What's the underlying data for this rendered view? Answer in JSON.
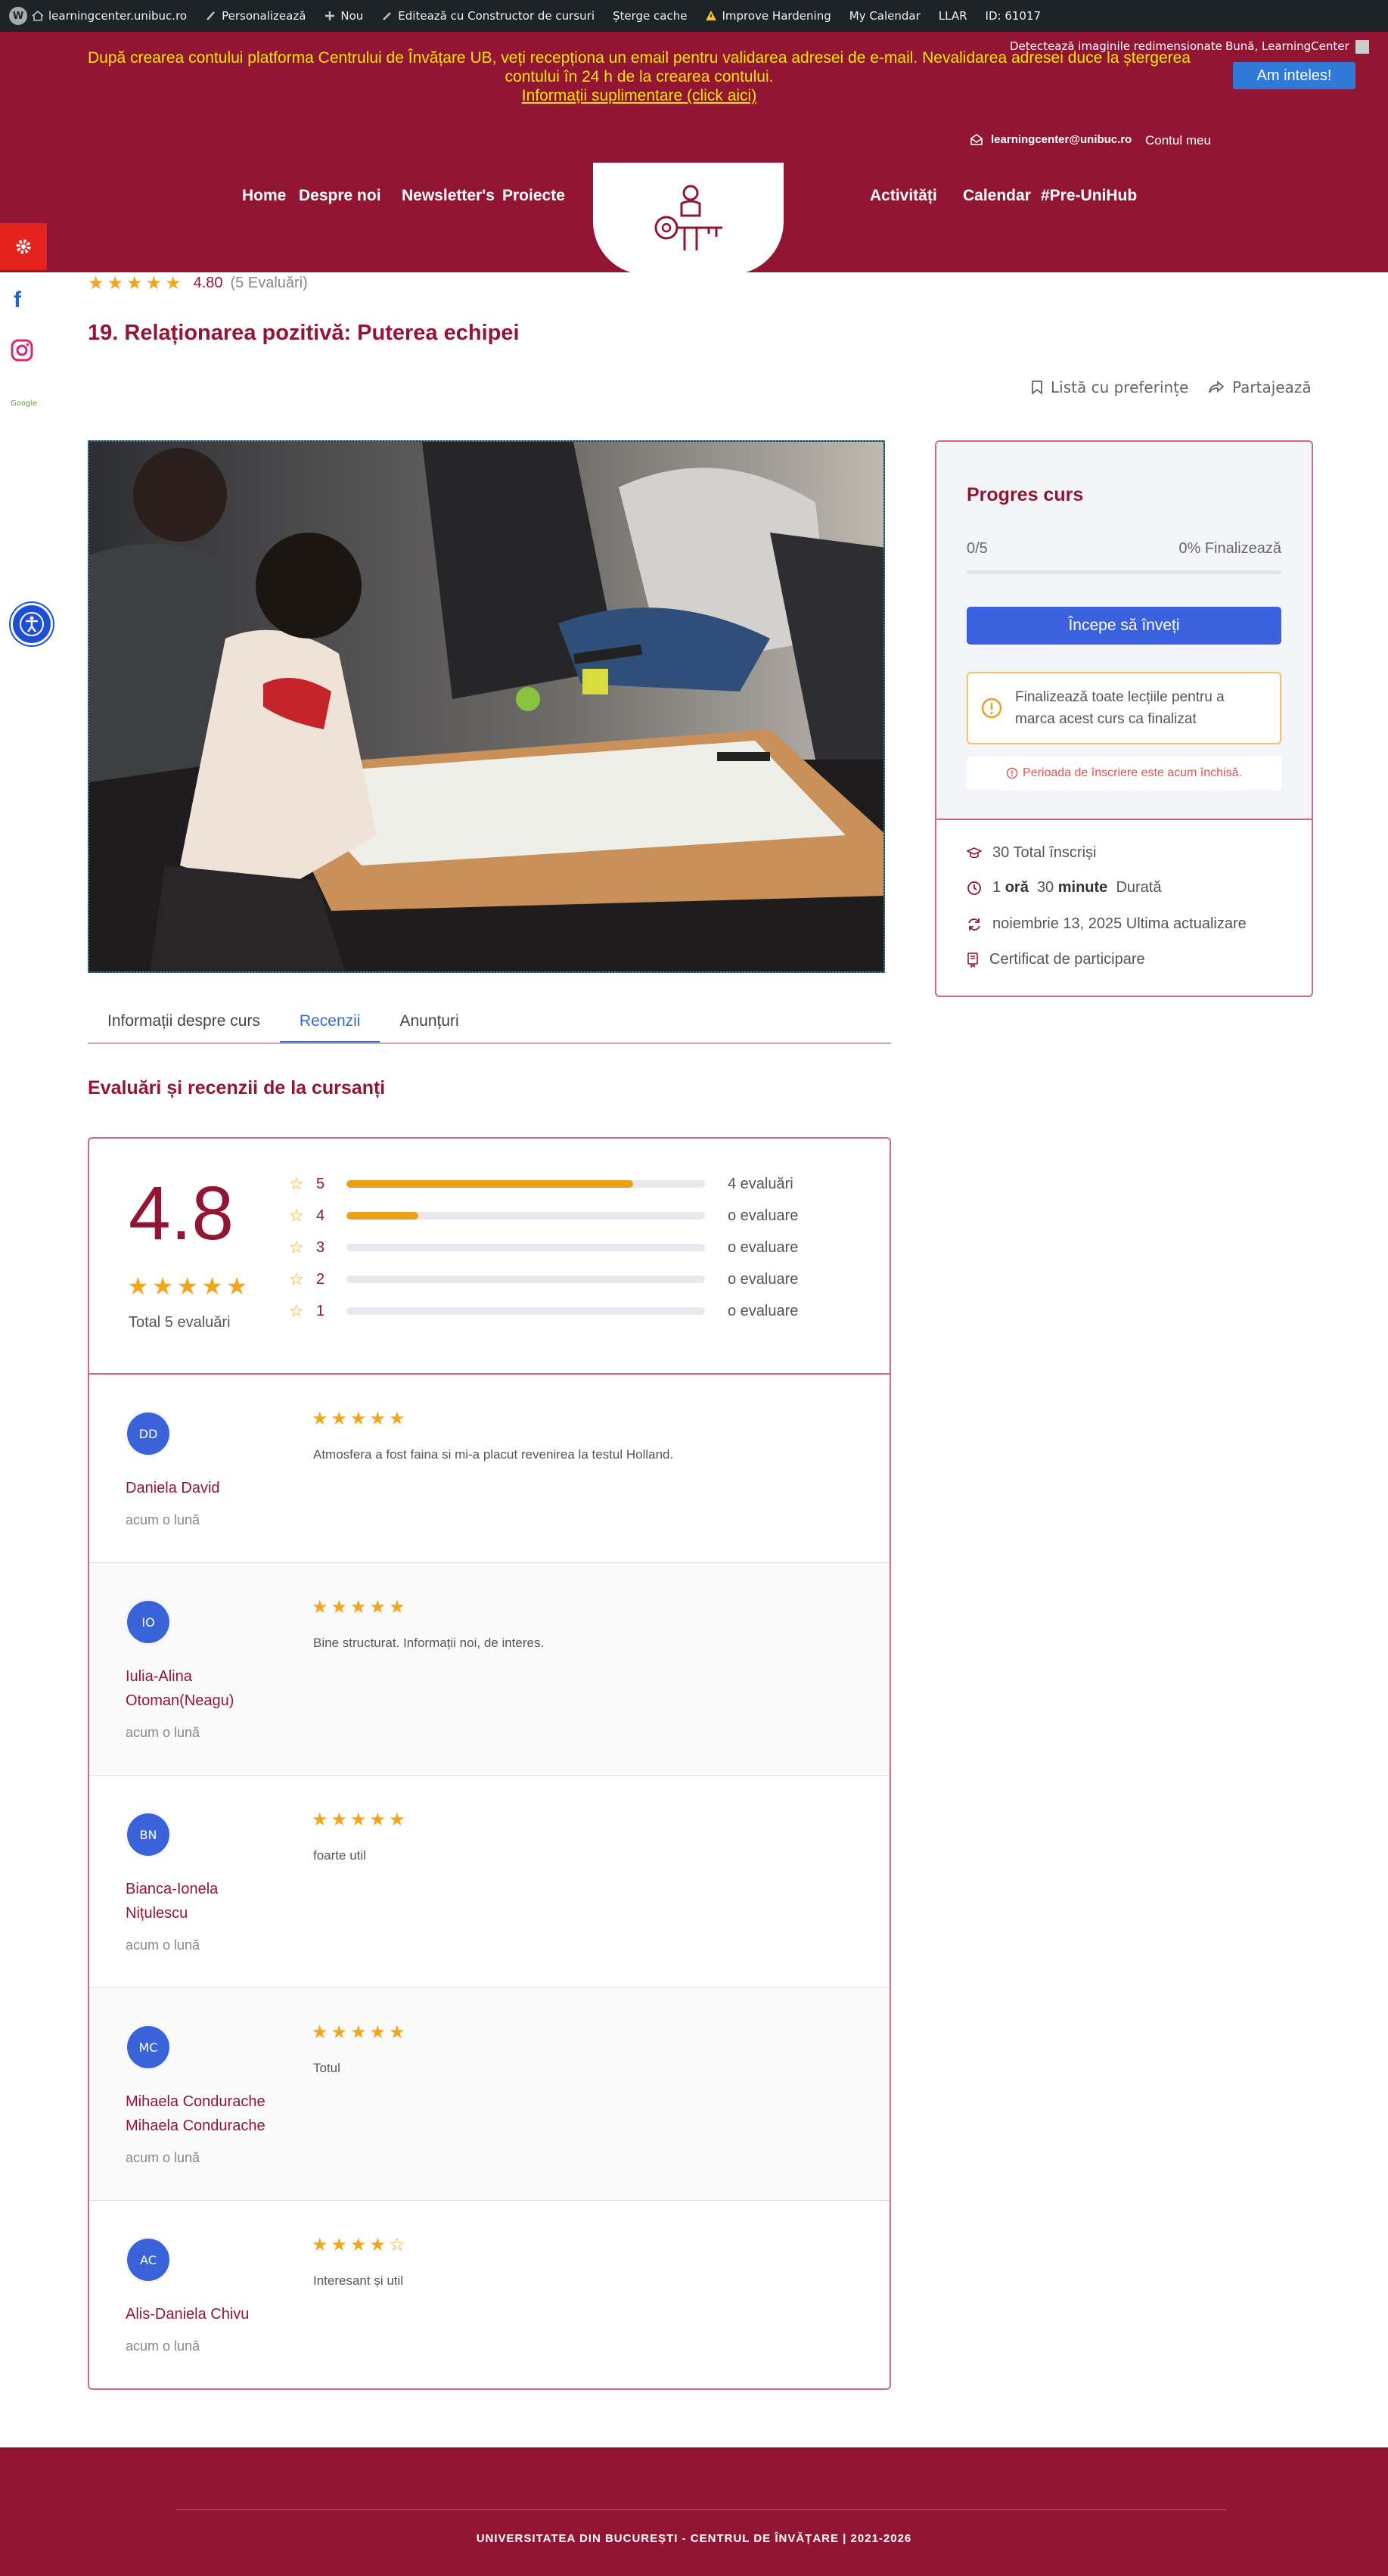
{
  "adminbar": {
    "site": "learningcenter.unibuc.ro",
    "customize": "Personalizează",
    "new": "Nou",
    "edit_builder": "Editează cu Constructor de cursuri",
    "clear_cache": "Șterge cache",
    "hardening": "Improve Hardening",
    "calendar": "My Calendar",
    "llar": "LLAR",
    "id": "ID: 61017"
  },
  "header": {
    "notice_line1": "După crearea contului platforma Centrului de Învățare UB, veți recepționa un email pentru validarea adresei de e-mail. Nevalidarea adresei duce la ștergerea contului în 24 h de la crearea contului.",
    "notice_link": "Informații suplimentare (click aici)",
    "ack_button": "Am inteles!",
    "detect_images": "Detectează imaginile redimensionate",
    "greeting": "Bună, LearningCenter",
    "email": "learningcenter@unibuc.ro",
    "account": "Contul meu",
    "nav": {
      "home": "Home",
      "about": "Despre noi",
      "newsletter": "Newsletter's",
      "projects": "Proiecte",
      "activities": "Activități",
      "calendar": "Calendar",
      "prehub": "#Pre-UniHub"
    }
  },
  "sidebar_social": {
    "google": "Google"
  },
  "course": {
    "rating_value": "4.80",
    "rating_count": "(5 Evaluări)",
    "title": "19. Relaționarea pozitivă: Puterea echipei",
    "wishlist": "Listă cu preferințe",
    "share": "Partajează"
  },
  "tabs": [
    {
      "label": "Informații despre curs"
    },
    {
      "label": "Recenzii"
    },
    {
      "label": "Anunțuri"
    }
  ],
  "reviews_heading": "Evaluări și recenzii de la cursanți",
  "summary": {
    "rating": "4.8",
    "total": "Total 5 evaluări",
    "bars": [
      {
        "star": "5",
        "fraction": 0.8,
        "label": "4 evaluări"
      },
      {
        "star": "4",
        "fraction": 0.2,
        "label": "o evaluare"
      },
      {
        "star": "3",
        "fraction": 0,
        "label": "o evaluare"
      },
      {
        "star": "2",
        "fraction": 0,
        "label": "o evaluare"
      },
      {
        "star": "1",
        "fraction": 0,
        "label": "o evaluare"
      }
    ]
  },
  "reviews": [
    {
      "initials": "DD",
      "name": "Daniela David",
      "time": "acum o lună",
      "stars": 5,
      "text": "Atmosfera a fost faina si mi-a placut revenirea la testul Holland."
    },
    {
      "initials": "IO",
      "name": "Iulia-Alina Otoman(Neagu)",
      "time": "acum o lună",
      "stars": 5,
      "text": "Bine structurat. Informații noi, de interes."
    },
    {
      "initials": "BN",
      "name": "Bianca-Ionela Nițulescu",
      "time": "acum o lună",
      "stars": 5,
      "text": "foarte util"
    },
    {
      "initials": "MC",
      "name": "Mihaela Condurache Mihaela Condurache",
      "time": "acum o lună",
      "stars": 5,
      "text": "Totul"
    },
    {
      "initials": "AC",
      "name": "Alis-Daniela Chivu",
      "time": "acum o lună",
      "stars": 4,
      "text": "Interesant și util"
    }
  ],
  "progress": {
    "title": "Progres curs",
    "count": "0/5",
    "percent": "0% Finalizează",
    "fraction": 0,
    "start_button": "Începe să înveți",
    "finish_note": "Finalizează toate lecțiile pentru a marca acest curs ca finalizat",
    "enroll_closed": "Perioada de înscriere este acum închisă."
  },
  "meta": {
    "enrolled": "30 Total înscriși",
    "duration_hours": "1",
    "duration_hours_unit": "oră",
    "duration_minutes": "30",
    "duration_minutes_unit": "minute",
    "duration_label": "Durată",
    "updated": "noiembrie 13, 2025 Ultima actualizare",
    "certificate": "Certificat de participare"
  },
  "footer": {
    "text": "UNIVERSITATEA DIN BUCUREȘTI - CENTRUL DE ÎNVĂȚARE | 2021-2026"
  },
  "colors": {
    "brand": "#921634",
    "accent_blue": "#3a61de",
    "star": "#f3a51c",
    "notice_yellow": "#f6e600"
  }
}
